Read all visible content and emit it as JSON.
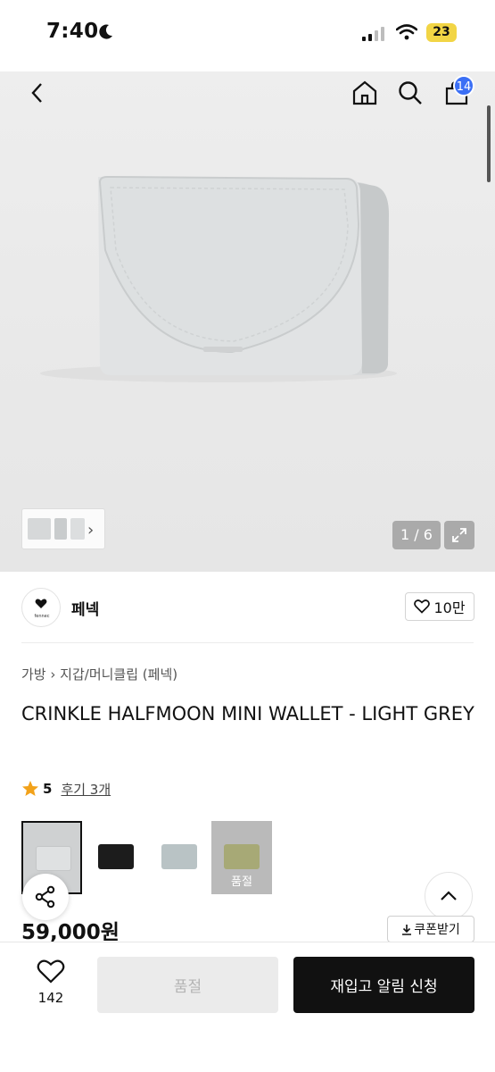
{
  "status_bar": {
    "time": "7:40",
    "battery": "23"
  },
  "nav": {
    "cart_count": "14"
  },
  "gallery": {
    "counter": "1 / 6",
    "thumb_arrow": "›"
  },
  "brand": {
    "name": "페넥",
    "logo_text": "fennec",
    "likes": "10만"
  },
  "breadcrumb": {
    "category": "가방",
    "separator": "›",
    "subcategory": "지갑/머니클립 (페넥)"
  },
  "product": {
    "title": "CRINKLE HALFMOON MINI WALLET - LIGHT GREY",
    "rating": "5",
    "reviews": "후기 3개",
    "price": "59,000원",
    "coupon": "쿠폰받기"
  },
  "variants": [
    {
      "color": "#cfd1d2",
      "selected": true
    },
    {
      "color": "#1c1c1c"
    },
    {
      "color": "#b9c3c5"
    },
    {
      "color": "#dfe28b",
      "soldout": true,
      "soldout_label": "품절"
    }
  ],
  "bottom": {
    "wish_count": "142",
    "soldout_label": "품절",
    "restock_label": "재입고 알림 신청"
  },
  "colors": {
    "accent_badge": "#3b6ff5",
    "star": "#f2a21a",
    "dark_button": "#111111"
  }
}
